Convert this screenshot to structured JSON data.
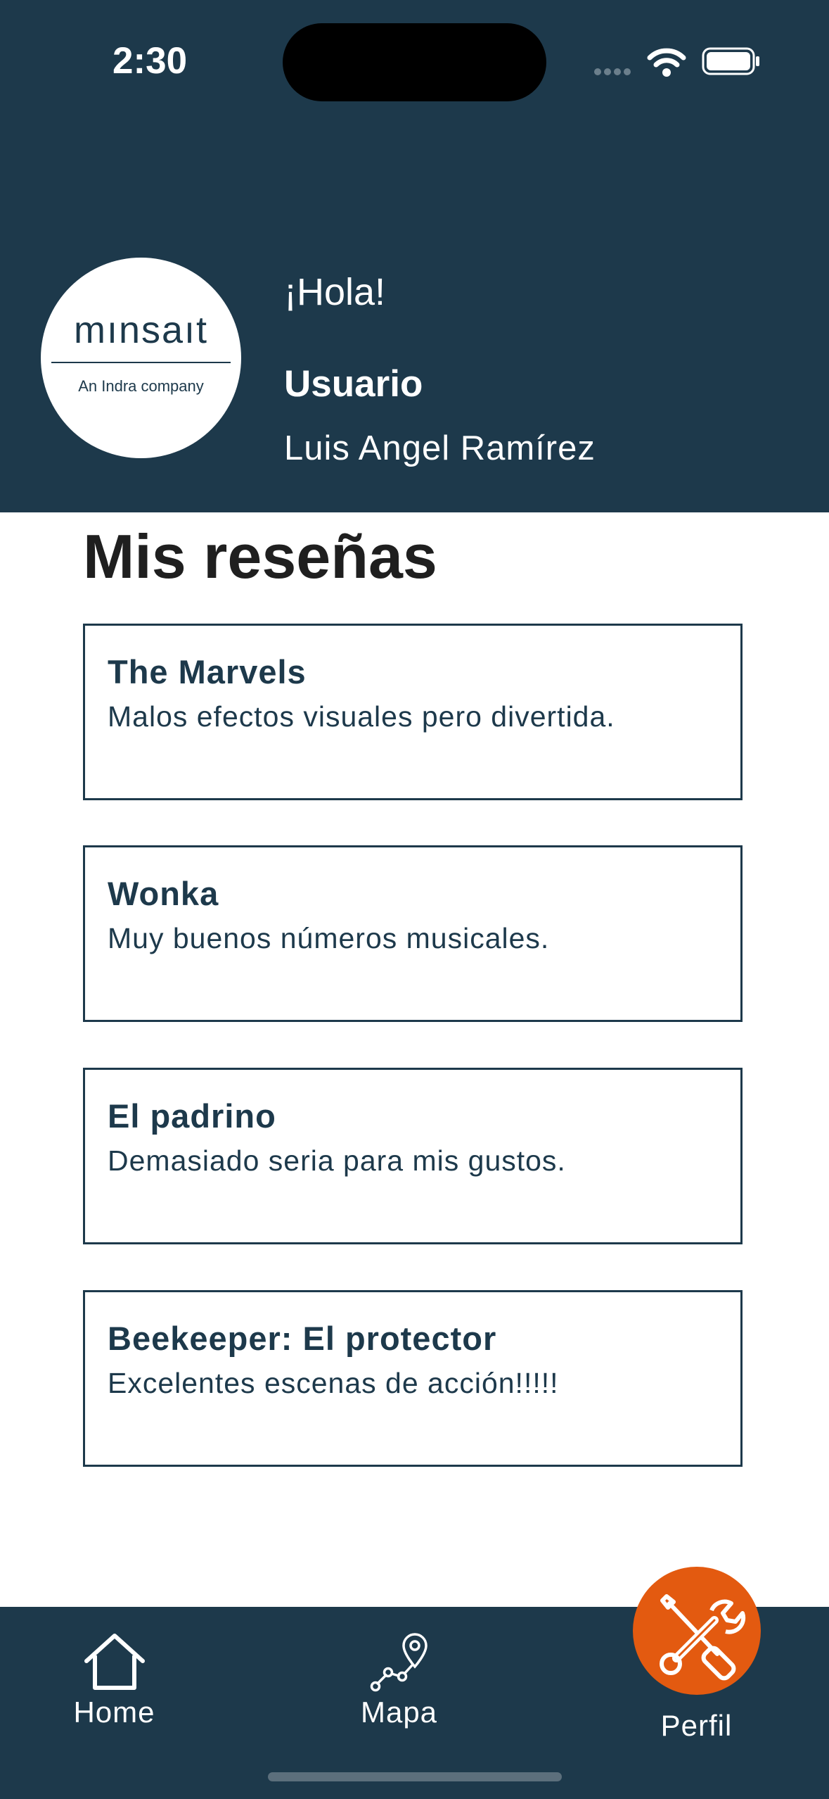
{
  "status_bar": {
    "time": "2:30",
    "icons": [
      "signal-icon",
      "wifi-icon",
      "battery-icon"
    ]
  },
  "header": {
    "avatar": {
      "logo_word": "mınsaıt",
      "logo_sub": "An Indra company"
    },
    "greeting": "¡Hola!",
    "user_label": "Usuario",
    "user_name": "Luis Angel Ramírez"
  },
  "reviews": {
    "title": "Mis reseñas",
    "items": [
      {
        "title": "The Marvels",
        "text": "Malos efectos visuales pero divertida."
      },
      {
        "title": "Wonka",
        "text": "Muy buenos números musicales."
      },
      {
        "title": "El padrino",
        "text": "Demasiado seria para mis gustos."
      },
      {
        "title": "Beekeeper: El protector",
        "text": "Excelentes escenas de acción!!!!!"
      }
    ]
  },
  "tabbar": {
    "home": {
      "label": "Home",
      "icon": "home-icon"
    },
    "map": {
      "label": "Mapa",
      "icon": "map-route-icon"
    },
    "profile": {
      "label": "Perfil",
      "icon": "tools-icon",
      "active": true
    }
  },
  "colors": {
    "primary": "#1d394b",
    "accent": "#e35a10",
    "background": "#ffffff"
  }
}
